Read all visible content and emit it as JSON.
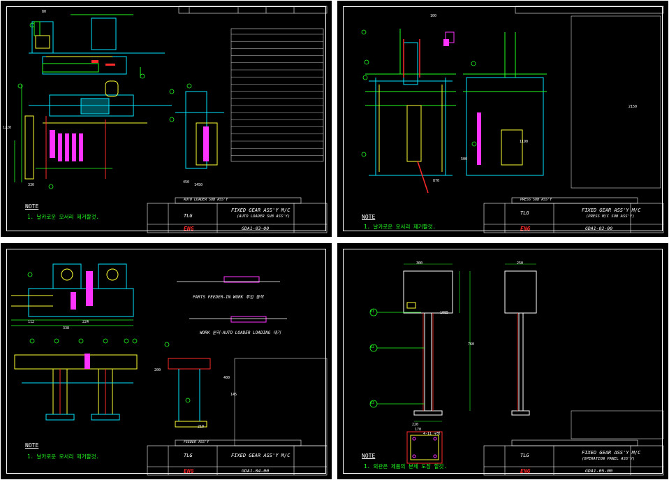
{
  "sheets": [
    {
      "id": "sheet1",
      "note_title": "NOTE",
      "note_text": "1. 날카로운 모서리 제거할것.",
      "title": "FIXED GEAR ASS'Y M/C",
      "subtitle": "(AUTO LOADER SUB ASS'Y)",
      "drawing_no": "GDA1-03-00",
      "brand": "ENG",
      "logo": "TLG",
      "assembly_label": "AUTO LOADER SUB ASS'Y"
    },
    {
      "id": "sheet2",
      "note_title": "NOTE",
      "note_text": "1. 날카로운 모서리 제거할것.",
      "title": "FIXED GEAR ASS'Y M/C",
      "subtitle": "(PRESS M/C SUB ASS'Y)",
      "drawing_no": "GDA1-02-00",
      "brand": "ENG",
      "logo": "TLG",
      "assembly_label": "PRESS SUB ASS'Y"
    },
    {
      "id": "sheet3",
      "note_title": "NOTE",
      "note_text": "1. 날카로운 모서리 제거할것.",
      "title": "FIXED GEAR ASS'Y M/C",
      "subtitle": "",
      "drawing_no": "GDA1-04-00",
      "brand": "ENG",
      "logo": "TLG",
      "assembly_label": "FEEDER ASS'Y",
      "caption1": "PARTS FEEDER-IN WORK 투입 동작",
      "caption2": "WORK 분리-AUTO LOADER LOADING 대기"
    },
    {
      "id": "sheet4",
      "note_title": "NOTE",
      "note_text": "1. 외관은 제품의 분체 도장 할것.",
      "title": "FIXED GEAR ASS'Y M/C",
      "subtitle": "(OPERATION PANEL ASS'Y)",
      "drawing_no": "GDA1-05-00",
      "brand": "ENG",
      "logo": "TLG"
    }
  ],
  "dimensions": {
    "s1": [
      "80",
      "450",
      "1220",
      "1450",
      "330"
    ],
    "s2": [
      "100",
      "2150",
      "870",
      "500",
      "1190"
    ],
    "s3": [
      "112",
      "224",
      "338",
      "200",
      "400",
      "145",
      "210"
    ],
    "s4": [
      "300",
      "250",
      "1085",
      "760",
      "220",
      "170",
      "4-11 구멍"
    ]
  },
  "balloons": {
    "s4": [
      "01",
      "02",
      "03"
    ]
  },
  "colors": {
    "background": "#000000",
    "frame": "#ffffff",
    "cyan": "#00e5ff",
    "green": "#22ff22",
    "yellow": "#ffff33",
    "red": "#ff2a2a",
    "magenta": "#ff33ff",
    "white": "#ffffff"
  }
}
